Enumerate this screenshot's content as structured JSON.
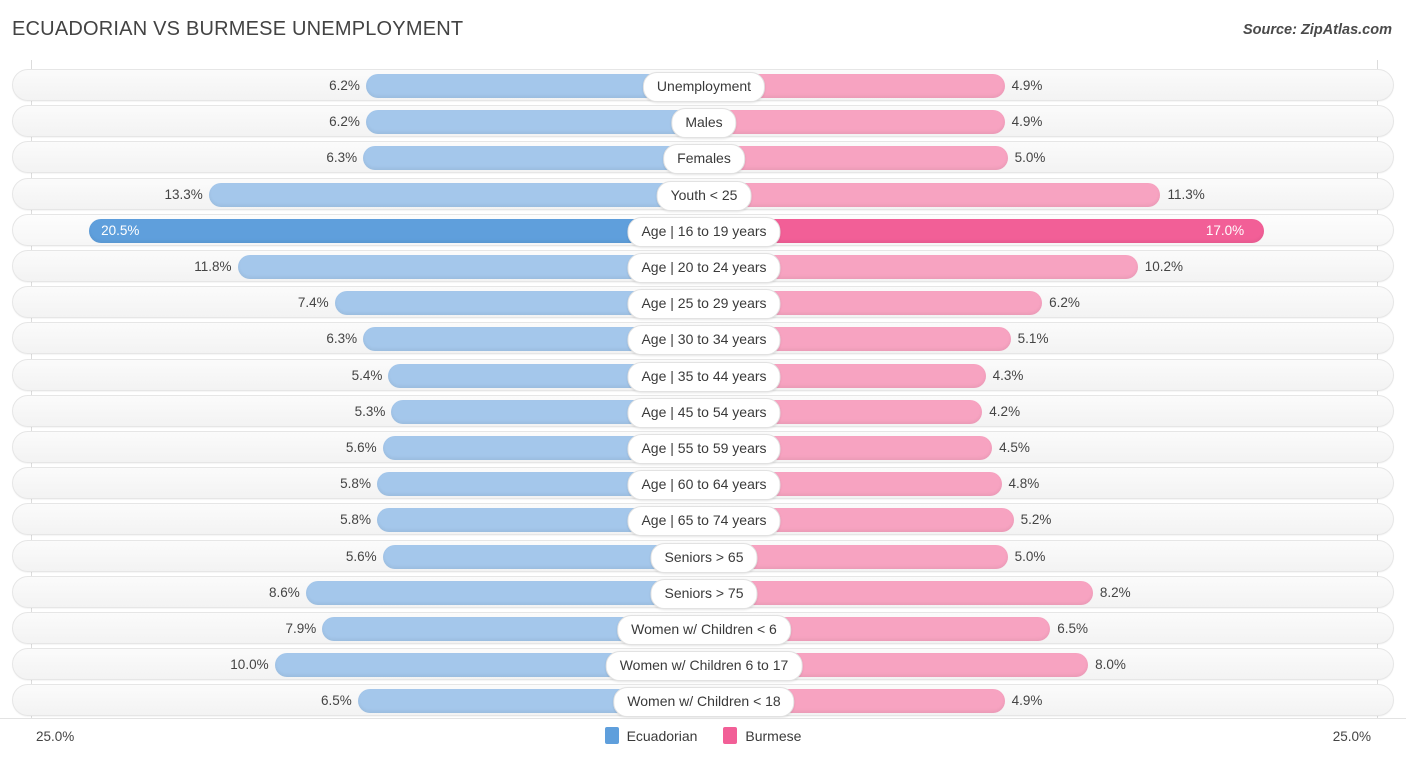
{
  "header": {
    "title": "ECUADORIAN VS BURMESE UNEMPLOYMENT",
    "source": "Source: ZipAtlas.com"
  },
  "axis": {
    "left_label": "25.0%",
    "right_label": "25.0%",
    "max": 25.0
  },
  "legend": {
    "items": [
      {
        "label": "Ecuadorian",
        "color": "#5f9fdc"
      },
      {
        "label": "Burmese",
        "color": "#f25f97"
      }
    ]
  },
  "colors": {
    "left_bar": "#a4c7eb",
    "right_bar": "#f7a3c1",
    "left_bar_highlight": "#5f9fdc",
    "right_bar_highlight": "#f25f97"
  },
  "chart_data": {
    "type": "bar",
    "title": "ECUADORIAN VS BURMESE UNEMPLOYMENT",
    "subtitle": "",
    "xlabel": "",
    "ylabel": "",
    "orientation": "horizontal-diverging",
    "xlim": [
      0,
      25.0
    ],
    "grid": false,
    "legend_position": "bottom-center",
    "categories": [
      "Unemployment",
      "Males",
      "Females",
      "Youth < 25",
      "Age | 16 to 19 years",
      "Age | 20 to 24 years",
      "Age | 25 to 29 years",
      "Age | 30 to 34 years",
      "Age | 35 to 44 years",
      "Age | 45 to 54 years",
      "Age | 55 to 59 years",
      "Age | 60 to 64 years",
      "Age | 65 to 74 years",
      "Seniors > 65",
      "Seniors > 75",
      "Women w/ Children < 6",
      "Women w/ Children 6 to 17",
      "Women w/ Children < 18"
    ],
    "series": [
      {
        "name": "Ecuadorian",
        "values": [
          6.2,
          6.2,
          6.3,
          13.3,
          20.5,
          11.8,
          7.4,
          6.3,
          5.4,
          5.3,
          5.6,
          5.8,
          5.8,
          5.6,
          8.6,
          7.9,
          10.0,
          6.5
        ],
        "labels": [
          "6.2%",
          "6.2%",
          "6.3%",
          "13.3%",
          "20.5%",
          "11.8%",
          "7.4%",
          "6.3%",
          "5.4%",
          "5.3%",
          "5.6%",
          "5.8%",
          "5.8%",
          "5.6%",
          "8.6%",
          "7.9%",
          "10.0%",
          "6.5%"
        ]
      },
      {
        "name": "Burmese",
        "values": [
          4.9,
          4.9,
          5.0,
          11.3,
          17.0,
          10.2,
          6.2,
          5.1,
          4.3,
          4.2,
          4.5,
          4.8,
          5.2,
          5.0,
          8.2,
          6.5,
          8.0,
          4.9
        ],
        "labels": [
          "4.9%",
          "4.9%",
          "5.0%",
          "11.3%",
          "17.0%",
          "10.2%",
          "6.2%",
          "5.1%",
          "4.3%",
          "4.2%",
          "4.5%",
          "4.8%",
          "5.2%",
          "5.0%",
          "8.2%",
          "6.5%",
          "8.0%",
          "4.9%"
        ]
      }
    ],
    "highlighted_category": "Age | 16 to 19 years"
  }
}
